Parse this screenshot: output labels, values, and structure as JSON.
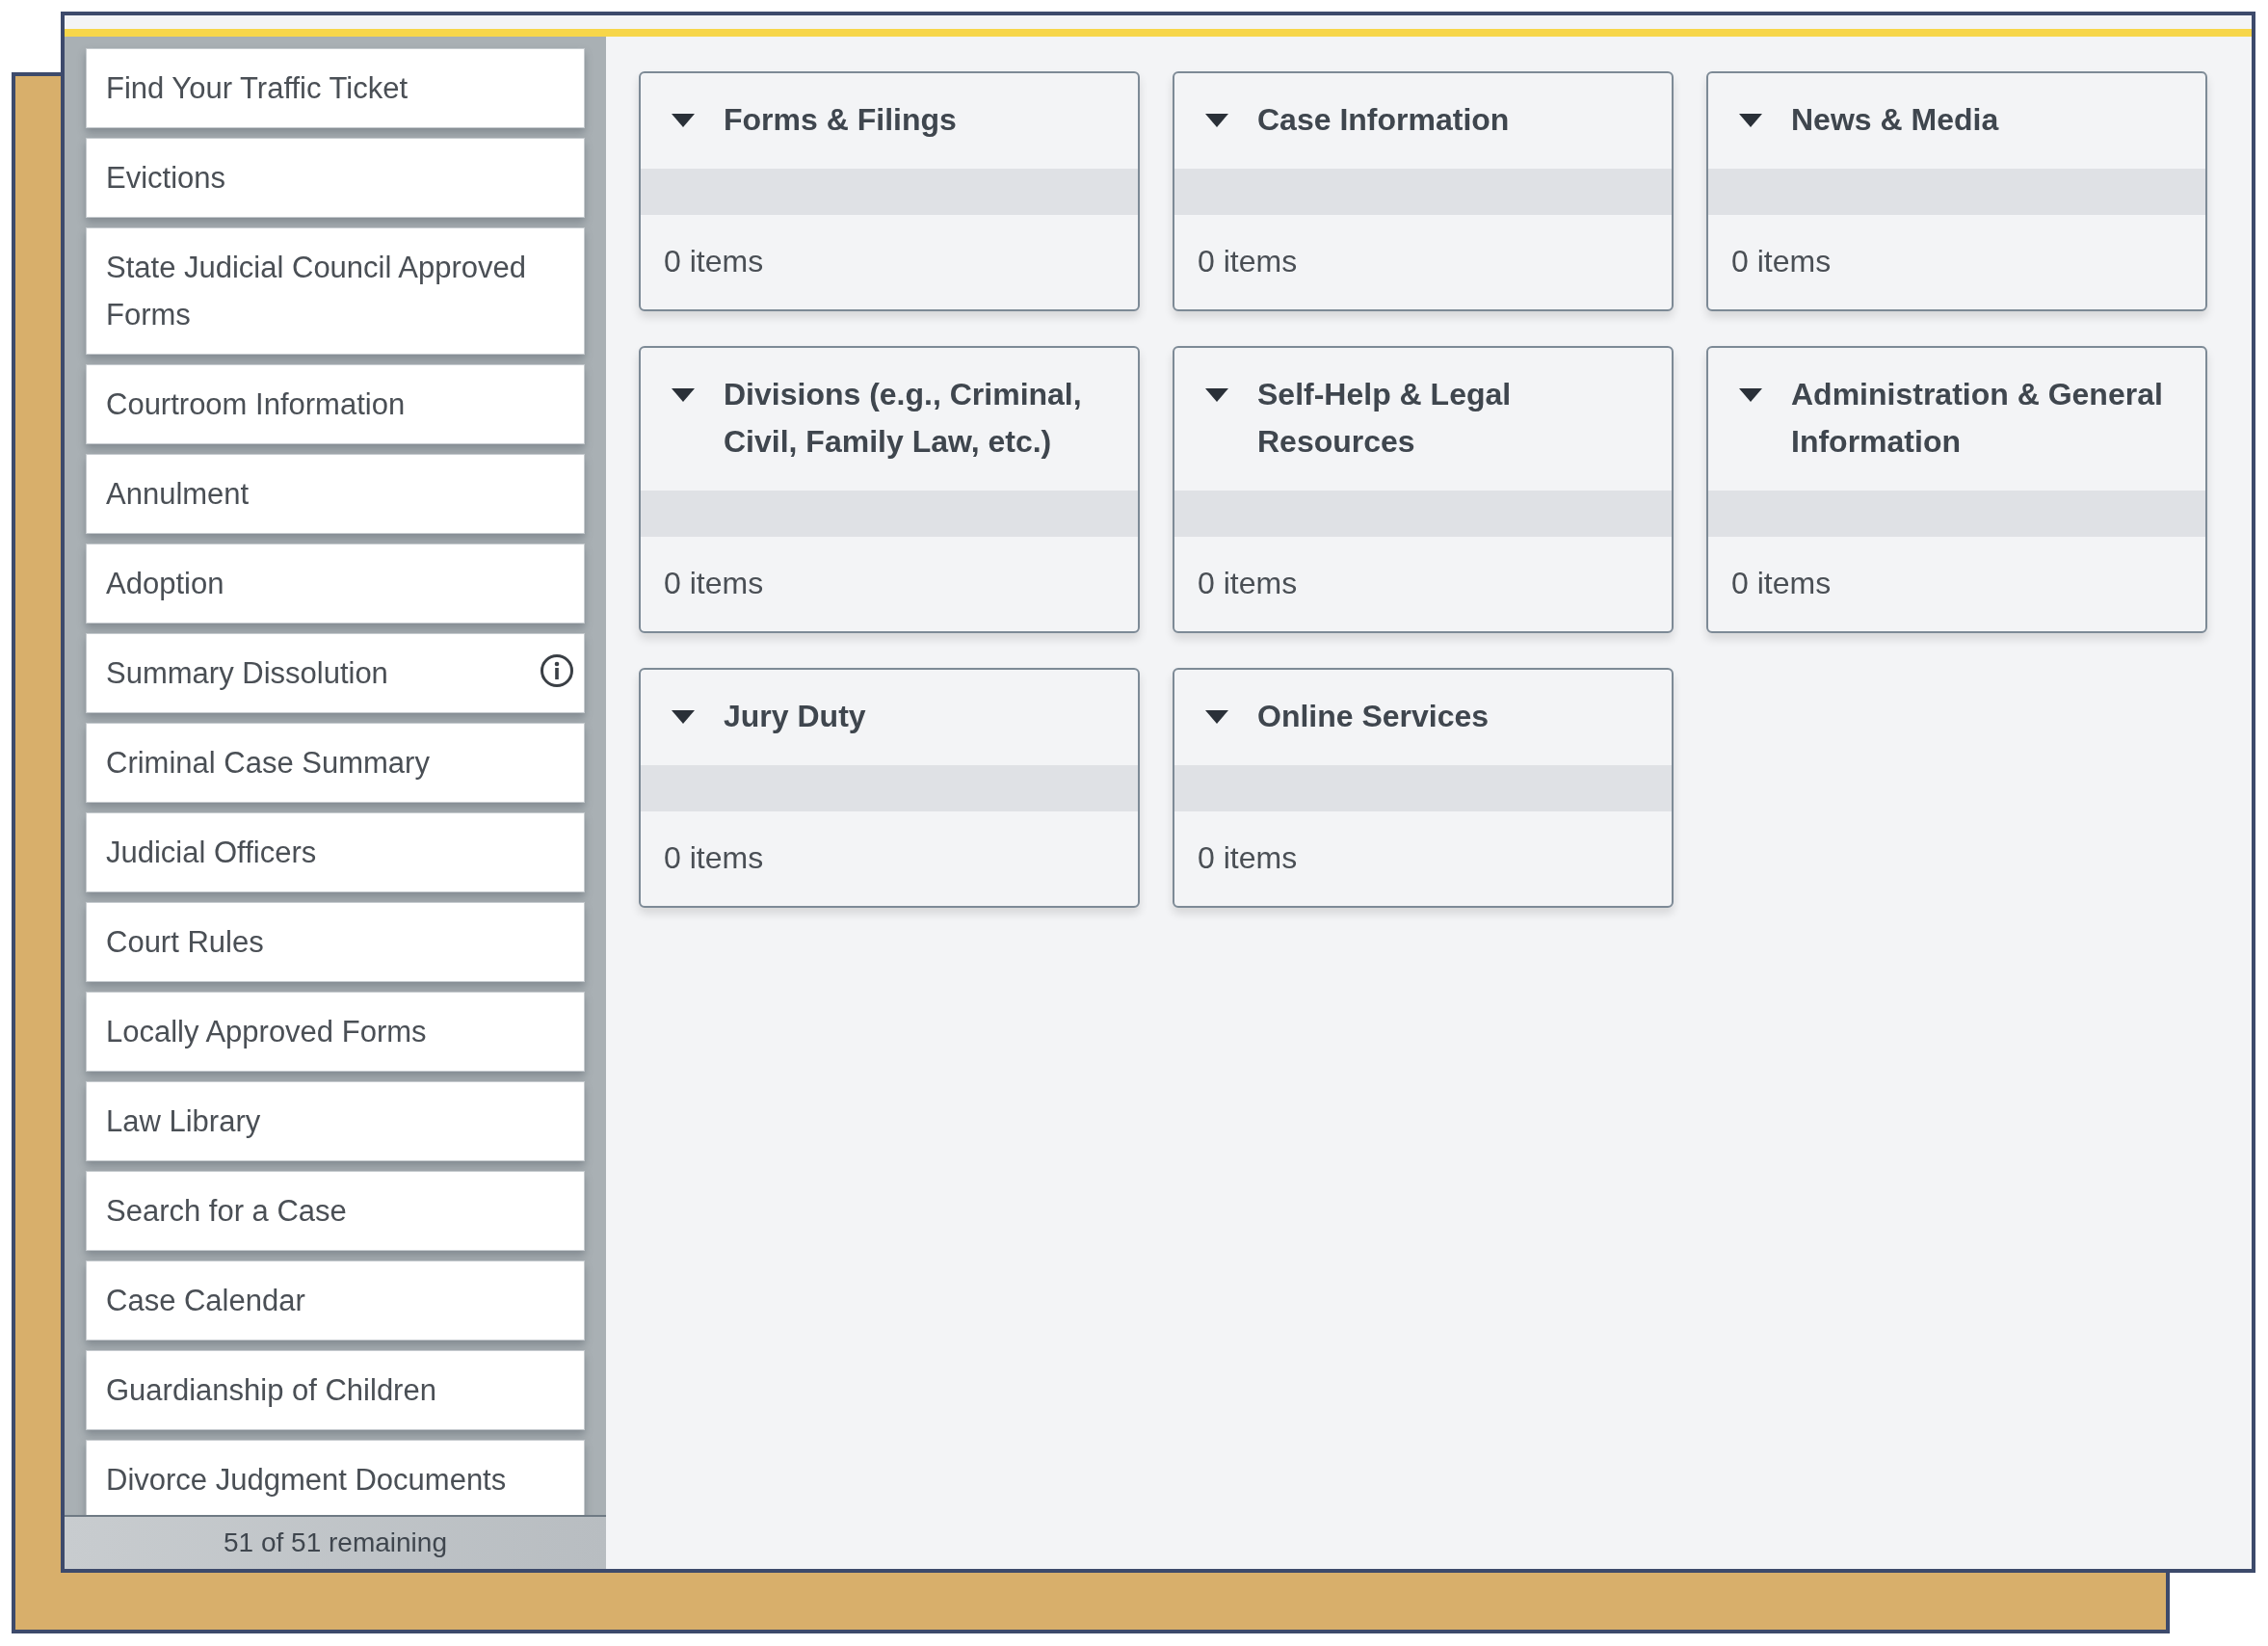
{
  "sidebar": {
    "items": [
      {
        "label": "Find Your Traffic Ticket",
        "info": false
      },
      {
        "label": "Evictions",
        "info": false
      },
      {
        "label": "State Judicial Council Approved Forms",
        "info": false
      },
      {
        "label": "Courtroom Information",
        "info": false
      },
      {
        "label": "Annulment",
        "info": false
      },
      {
        "label": "Adoption",
        "info": false
      },
      {
        "label": "Summary Dissolution",
        "info": true
      },
      {
        "label": "Criminal Case Summary",
        "info": false
      },
      {
        "label": "Judicial Officers",
        "info": false
      },
      {
        "label": "Court Rules",
        "info": false
      },
      {
        "label": "Locally Approved Forms",
        "info": false
      },
      {
        "label": "Law Library",
        "info": false
      },
      {
        "label": "Search for a Case",
        "info": false
      },
      {
        "label": "Case Calendar",
        "info": false
      },
      {
        "label": "Guardianship of Children",
        "info": false
      },
      {
        "label": "Divorce Judgment Documents",
        "info": false
      }
    ],
    "footer": "51 of 51 remaining"
  },
  "columns": [
    [
      {
        "title": "Forms & Filings",
        "expanded": true,
        "count": "0 items"
      },
      {
        "title": "Divisions (e.g., Criminal, Civil, Family Law, etc.)",
        "expanded": true,
        "count": "0 items"
      },
      {
        "title": "Jury Duty",
        "expanded": true,
        "count": "0 items"
      }
    ],
    [
      {
        "title": "Case Information",
        "expanded": true,
        "count": "0 items"
      },
      {
        "title": "Self-Help & Legal Resources",
        "expanded": true,
        "count": "0 items"
      },
      {
        "title": "Online Services",
        "expanded": true,
        "count": "0 items"
      }
    ],
    [
      {
        "title": "News & Media",
        "expanded": true,
        "count": "0 items"
      },
      {
        "title": "Administration & General Information",
        "expanded": true,
        "count": "0 items"
      }
    ]
  ]
}
